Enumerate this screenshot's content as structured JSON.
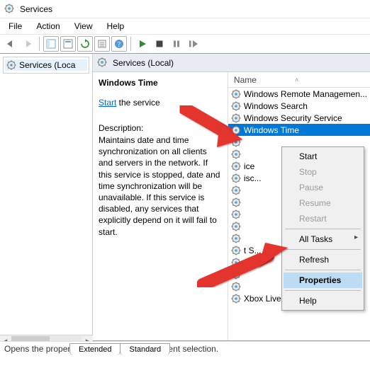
{
  "title": "Services",
  "menus": {
    "file": "File",
    "action": "Action",
    "view": "View",
    "help": "Help"
  },
  "left": {
    "node": "Services (Loca"
  },
  "panel": {
    "heading": "Services (Local)",
    "name": "Windows Time",
    "start_link": "Start",
    "start_rest": " the service",
    "desc_label": "Description:",
    "desc": "Maintains date and time synchronization on all clients and servers in the network. If this service is stopped, date and time synchronization will be unavailable. If this service is disabled, any services that explicitly depend on it will fail to start."
  },
  "column": {
    "name": "Name"
  },
  "services": [
    "Windows Remote Managemen...",
    "Windows Search",
    "Windows Security Service",
    "Windows Time",
    "",
    "",
    "ice",
    "isc...",
    "",
    "",
    "",
    "",
    "",
    "t S...",
    "",
    "",
    "",
    "Xbox Live Networking Service"
  ],
  "selectedIndex": 3,
  "context": {
    "start": "Start",
    "stop": "Stop",
    "pause": "Pause",
    "resume": "Resume",
    "restart": "Restart",
    "alltasks": "All Tasks",
    "refresh": "Refresh",
    "properties": "Properties",
    "help": "Help"
  },
  "tabs": {
    "extended": "Extended",
    "standard": "Standard"
  },
  "status": "Opens the properties dialog box for the current selection."
}
